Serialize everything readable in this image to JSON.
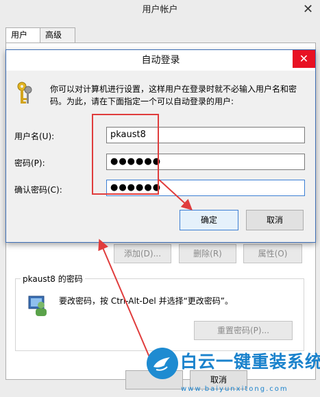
{
  "parent": {
    "title": "用户帐户",
    "tabs": [
      {
        "label": "用户"
      },
      {
        "label": "高级"
      }
    ],
    "buttons": {
      "add": "添加(D)...",
      "delete": "删除(R)",
      "properties": "属性(O)"
    },
    "password_group": {
      "title": "pkaust8 的密码",
      "text": "要改密码，按 Ctrl-Alt-Del 并选择“更改密码”。",
      "reset_button": "重置密码(P)..."
    },
    "cancel_button": "取消"
  },
  "dialog": {
    "title": "自动登录",
    "description": "你可以对计算机进行设置，这样用户在登录时就不必输入用户名和密码。为此，请在下面指定一个可以自动登录的用户:",
    "fields": {
      "username": {
        "label": "用户名(U):",
        "value": "pkaust8"
      },
      "password": {
        "label": "密码(P):",
        "value": "●●●●●●"
      },
      "confirm": {
        "label": "确认密码(C):",
        "value": "●●●●●●"
      }
    },
    "ok_button": "确定",
    "cancel_button": "取消"
  },
  "annotation": {
    "color": "#e03c3c"
  },
  "watermark": {
    "text": "白云一键重装系统",
    "url": "www.baiyunxitong.com"
  }
}
